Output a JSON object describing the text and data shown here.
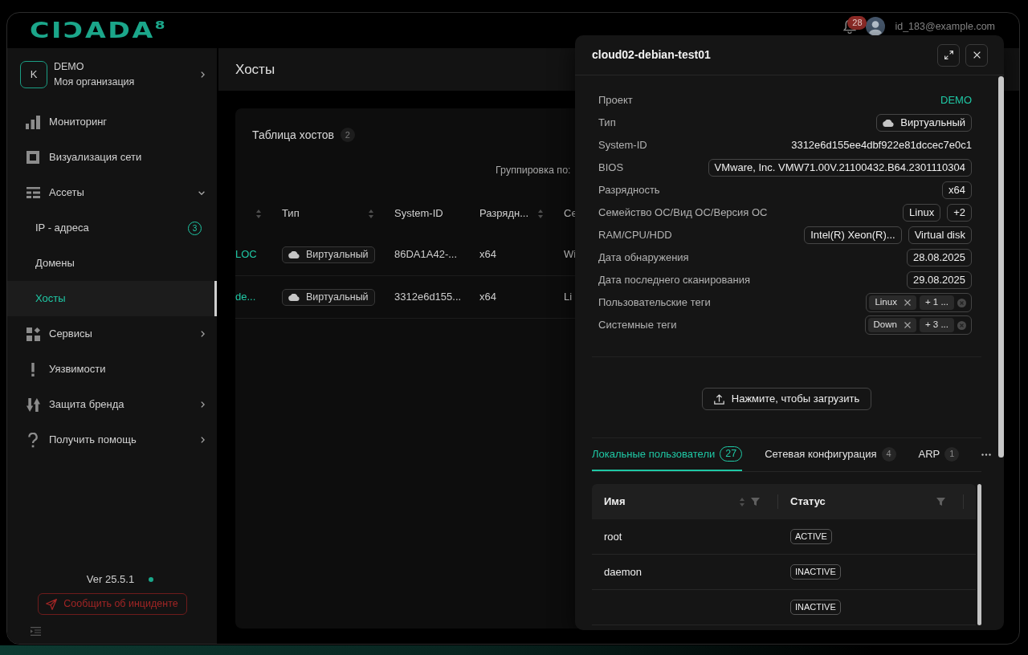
{
  "header": {
    "logo": "CIƆADA$^{8}$",
    "notifications": "28",
    "user_email": "id_183@example.com"
  },
  "sidebar": {
    "organization": {
      "avatar": "K",
      "name": "DEMO",
      "subtitle": "Моя организация"
    },
    "items": [
      {
        "label": "Мониторинг",
        "selected": false
      },
      {
        "label": "Визуализация сети",
        "selected": false
      },
      {
        "label": "Ассеты",
        "selected": false,
        "expanded": true,
        "children": [
          {
            "label": "IP - адреса",
            "badge": "3",
            "selected": false
          },
          {
            "label": "Домены",
            "selected": false
          },
          {
            "label": "Хосты",
            "selected": true
          }
        ]
      },
      {
        "label": "Сервисы",
        "selected": false,
        "expanded": false
      },
      {
        "label": "Уязвимости",
        "selected": false
      },
      {
        "label": "Защита бренда",
        "selected": false,
        "expanded": false
      },
      {
        "label": "Получить помощь",
        "selected": false,
        "expanded": false
      }
    ],
    "version": "Ver 25.5.1",
    "online": true,
    "report_button": "Сообщить об инциденте"
  },
  "page": {
    "title": "Хосты",
    "card_title": "Таблица хостов",
    "card_count": "2",
    "grouping_label": "Группировка по:",
    "table": {
      "columns": [
        {
          "kind": "link",
          "sortable": true
        },
        {
          "label": "Тип",
          "kind": "type",
          "sortable": true
        },
        {
          "label": "System-ID",
          "kind": "text",
          "sortable": false
        },
        {
          "label": "Разрядн...",
          "kind": "text",
          "sortable": true
        },
        {
          "label": "Се",
          "kind": "text"
        }
      ],
      "rows": [
        [
          "LOC",
          "Виртуальный",
          "86DA1A42-...",
          "x64",
          "Wi"
        ],
        [
          "de...",
          "Виртуальный",
          "3312e6d155...",
          "x64",
          "Li"
        ]
      ]
    }
  },
  "drawer": {
    "title": "cloud02-debian-test01",
    "fields": [
      {
        "label": "Проект",
        "kind": "link",
        "value": "DEMO"
      },
      {
        "label": "Тип",
        "kind": "type",
        "value": "Виртуальный"
      },
      {
        "label": "System-ID",
        "kind": "text",
        "value": "3312e6d155ee4dbf922e81dccec7e0c1"
      },
      {
        "label": "BIOS",
        "kind": "tags",
        "values": [
          "VMware, Inc. VMW71.00V.21100432.B64.2301110304"
        ]
      },
      {
        "label": "Разрядность",
        "kind": "tags",
        "values": [
          "x64"
        ]
      },
      {
        "label": "Семейство ОС/Вид ОС/Версия ОС",
        "kind": "tags",
        "values": [
          "Linux",
          "+2"
        ]
      },
      {
        "label": "RAM/CPU/HDD",
        "kind": "tags",
        "values": [
          "Intel(R) Xeon(R)...",
          "Virtual disk"
        ]
      },
      {
        "label": "Дата обнаружения",
        "kind": "tags",
        "values": [
          "28.08.2025"
        ]
      },
      {
        "label": "Дата последнего сканирования",
        "kind": "tags",
        "values": [
          "29.08.2025"
        ]
      },
      {
        "label": "Пользовательские теги",
        "kind": "select",
        "tags": [
          {
            "label": "Linux",
            "removable": true
          },
          {
            "label": "+ 1 ...",
            "removable": false
          }
        ]
      },
      {
        "label": "Системные теги",
        "kind": "select",
        "tags": [
          {
            "label": "Down",
            "removable": true
          },
          {
            "label": "+ 3 ...",
            "removable": false
          }
        ]
      }
    ],
    "upload_button": "Нажмите, чтобы загрузить",
    "tabs": [
      {
        "label": "Локальные пользователи",
        "count": "27",
        "selected": true
      },
      {
        "label": "Сетевая конфигурация",
        "count": "4",
        "selected": false
      },
      {
        "label": "ARP",
        "count": "1",
        "selected": false
      }
    ],
    "users_table": {
      "columns": [
        {
          "label": "Имя",
          "sortable": true,
          "filterable": true
        },
        {
          "label": "Статус",
          "sortable": false,
          "filterable": true
        }
      ],
      "rows": [
        {
          "name": "root",
          "status": "ACTIVE"
        },
        {
          "name": "daemon",
          "status": "INACTIVE"
        },
        {
          "status": "INACTIVE"
        }
      ]
    }
  }
}
